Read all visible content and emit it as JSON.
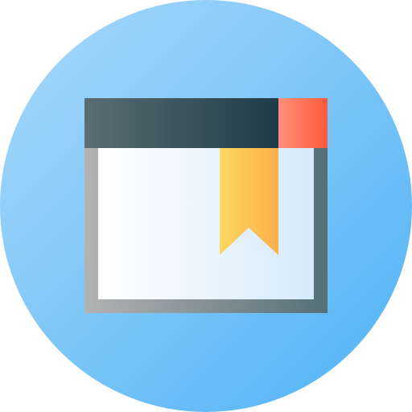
{
  "icon": {
    "name": "bookmarked-browser-window-icon",
    "colors": {
      "circle_start": "#a9d9fb",
      "circle_end": "#4fb2f5",
      "frame_start": "#b3b3b3",
      "frame_end": "#546f78",
      "page_start": "#ffffff",
      "page_end": "#d6eafb",
      "titlebar_start": "#5a6e73",
      "titlebar_end": "#1f3b48",
      "close_start": "#ff8f7a",
      "close_end": "#ff5b3a",
      "bookmark_start": "#fdd760",
      "bookmark_end": "#fbb04b"
    }
  }
}
